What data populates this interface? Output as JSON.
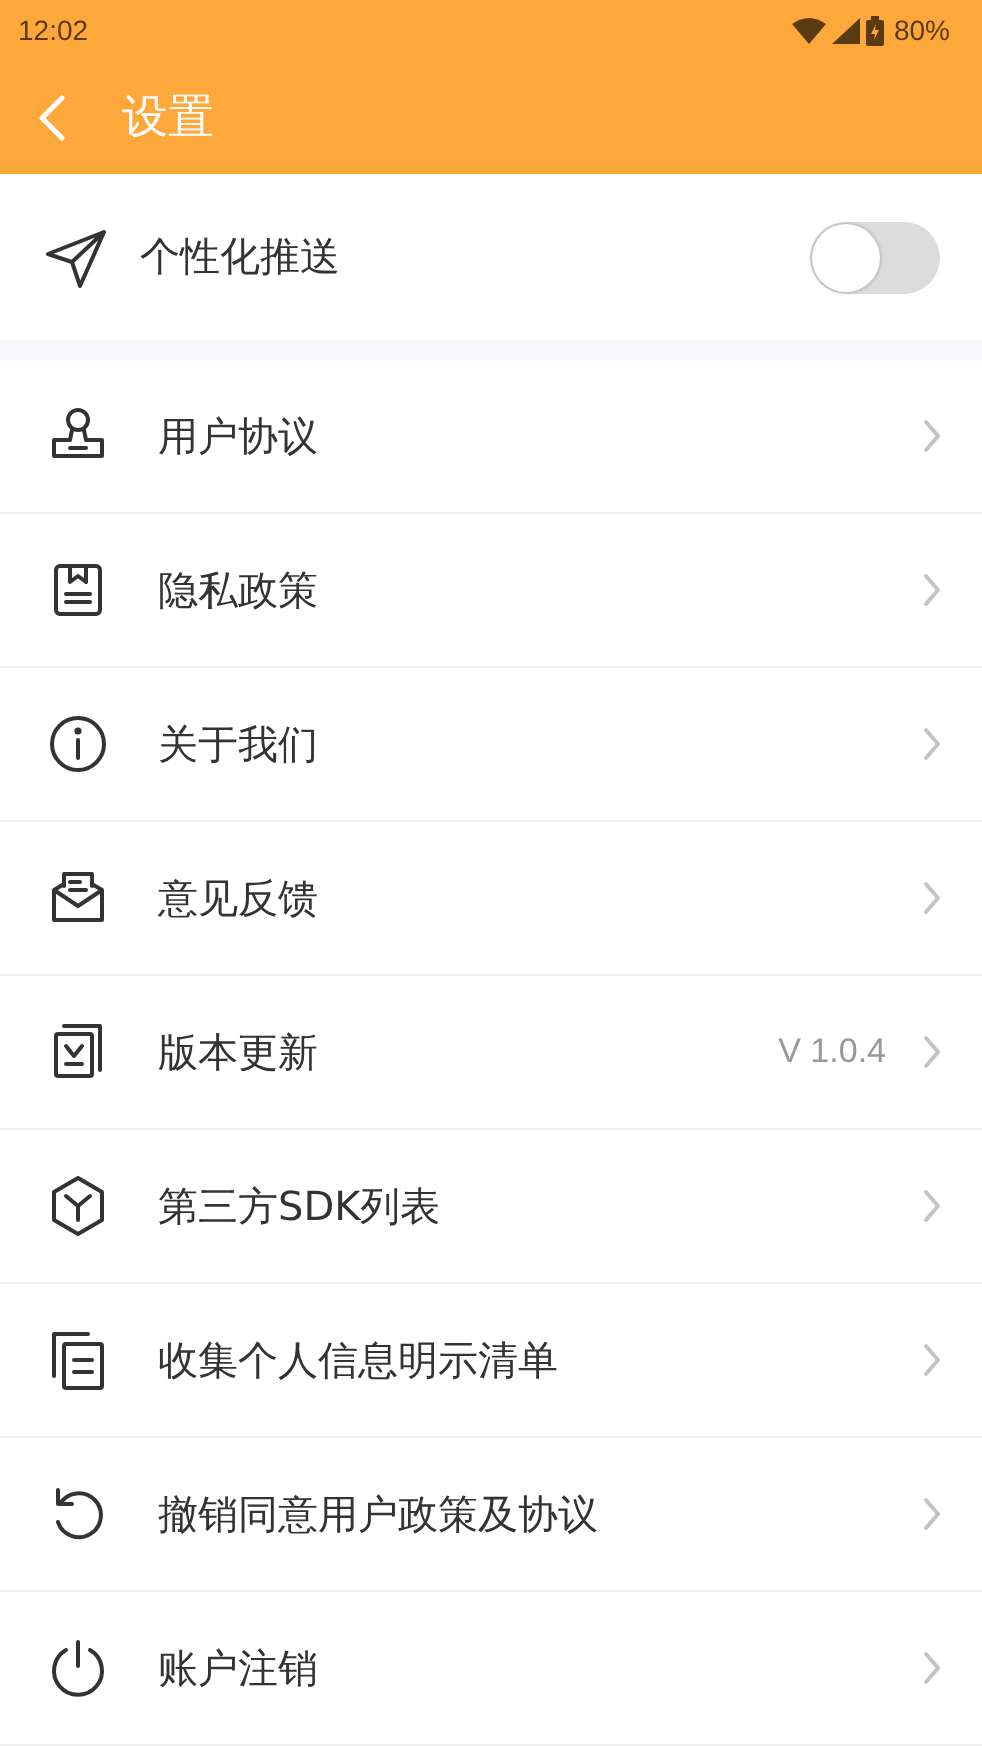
{
  "status_bar": {
    "time": "12:02",
    "battery": "80%"
  },
  "header": {
    "title": "设置"
  },
  "push": {
    "label": "个性化推送",
    "on": false
  },
  "items": [
    {
      "label": "用户协议"
    },
    {
      "label": "隐私政策"
    },
    {
      "label": "关于我们"
    },
    {
      "label": "意见反馈"
    },
    {
      "label": "版本更新",
      "value": "V 1.0.4"
    },
    {
      "label": "第三方SDK列表"
    },
    {
      "label": "收集个人信息明示清单"
    },
    {
      "label": "撤销同意用户政策及协议"
    },
    {
      "label": "账户注销"
    }
  ]
}
